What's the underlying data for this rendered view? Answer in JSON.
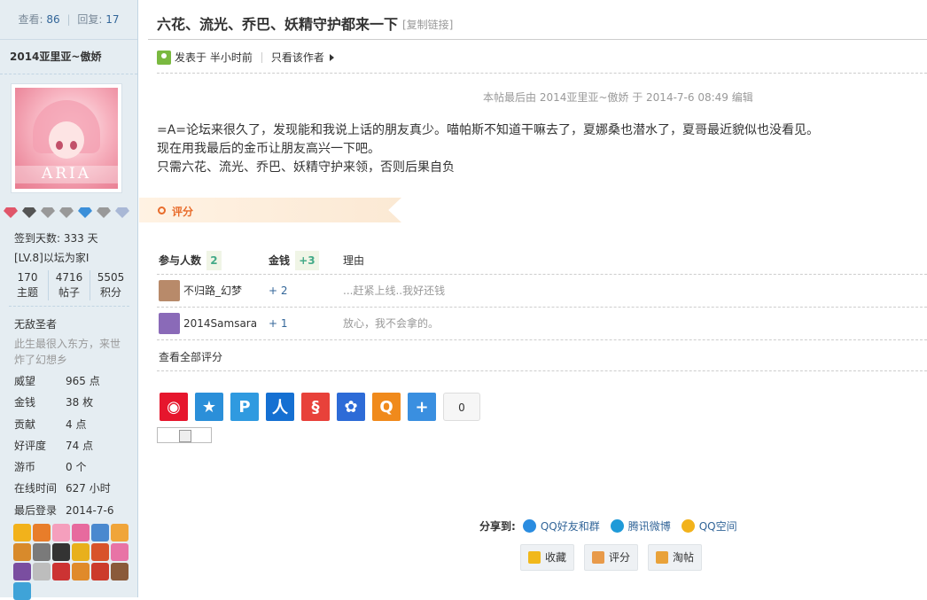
{
  "sidebar": {
    "views_label": "查看:",
    "views": "86",
    "replies_label": "回复:",
    "replies": "17",
    "author": "2014亚里亚~傲娇",
    "avatar_text": "ARIA",
    "checkin": "签到天数: 333 天",
    "level": "[LV.8]以坛为家I",
    "stats": [
      {
        "value": "170",
        "label": "主题"
      },
      {
        "value": "4716",
        "label": "帖子"
      },
      {
        "value": "5505",
        "label": "积分"
      }
    ],
    "title": "无敌圣者",
    "signature": "此生最很入东方，来世炸了幻想乡",
    "props": [
      {
        "k": "威望",
        "v": "965 点"
      },
      {
        "k": "金钱",
        "v": "38 枚"
      },
      {
        "k": "贡献",
        "v": "4 点"
      },
      {
        "k": "好评度",
        "v": "74 点"
      },
      {
        "k": "游币",
        "v": "0 个"
      },
      {
        "k": "在线时间",
        "v": "627 小时"
      },
      {
        "k": "最后登录",
        "v": "2014-7-6"
      }
    ],
    "gem_colors": [
      "#e0566a",
      "#555",
      "#999",
      "#999",
      "#3b8fd9",
      "#999",
      "#a9b8d6"
    ],
    "badge_colors": [
      "#f2b21b",
      "#e87d2a",
      "#f59fbd",
      "#e76a9e",
      "#4a89cf",
      "#f0a53a",
      "#d88a2b",
      "#7a7a7a",
      "#333",
      "#e8b01c",
      "#d8532b",
      "#e873a6",
      "#7a4ea0",
      "#bdbdbd",
      "#c33",
      "#e08a2a",
      "#cc3b2b",
      "#8a5a3a",
      "#3fa3d8"
    ]
  },
  "post": {
    "title": "六花、流光、乔巴、妖精守护都来一下",
    "copy_link": "[复制链接]",
    "posted": "发表于 半小时前",
    "only_author": "只看该作者",
    "edited": "本帖最后由 2014亚里亚~傲娇 于 2014-7-6 08:49 编辑",
    "lines": [
      "=A=论坛来很久了，发现能和我说上话的朋友真少。喵帕斯不知道干嘛去了，夏娜桑也潜水了，夏哥最近貌似也没看见。",
      "现在用我最后的金币让朋友高兴一下吧。",
      "只需六花、流光、乔巴、妖精守护来领，否则后果自负"
    ]
  },
  "rating": {
    "label": "评分",
    "participants_label": "参与人数",
    "participants": "2",
    "money_label": "金钱",
    "money_total": "+3",
    "reason_label": "理由",
    "rows": [
      {
        "user": "不归路_幻梦",
        "points": "+ 2",
        "reason": "...赶紧上线..我好还钱",
        "avatar_color": "#b88a6a"
      },
      {
        "user": "2014Samsara",
        "points": "+ 1",
        "reason": "放心，我不会拿的。",
        "avatar_color": "#8a6ab8"
      }
    ],
    "view_all": "查看全部评分"
  },
  "share": {
    "icons": [
      {
        "name": "weibo-share-icon",
        "color": "#e6162d",
        "glyph": "◉"
      },
      {
        "name": "qzone-share-icon",
        "color": "#2b8fd9",
        "glyph": "★"
      },
      {
        "name": "tencent-weibo-share-icon",
        "color": "#2f9ae0",
        "glyph": "P"
      },
      {
        "name": "renren-share-icon",
        "color": "#1570d2",
        "glyph": "人"
      },
      {
        "name": "kaixin-share-icon",
        "color": "#e8413a",
        "glyph": "§"
      },
      {
        "name": "baidu-share-icon",
        "color": "#2d6bd7",
        "glyph": "✿"
      },
      {
        "name": "qq-bookmark-share-icon",
        "color": "#f08a1c",
        "glyph": "Q"
      },
      {
        "name": "more-share-icon",
        "color": "#3a8fe0",
        "glyph": "+"
      }
    ],
    "count": "0",
    "share_to_label": "分享到:",
    "targets": [
      {
        "label": "QQ好友和群",
        "color": "#2a8ce0"
      },
      {
        "label": "腾讯微博",
        "color": "#1f9ad8"
      },
      {
        "label": "QQ空间",
        "color": "#f2b21b"
      }
    ]
  },
  "actions": [
    {
      "name": "favorite-button",
      "label": "收藏",
      "color": "#f1b81b"
    },
    {
      "name": "rate-button",
      "label": "评分",
      "color": "#e89a4a"
    },
    {
      "name": "tao-post-button",
      "label": "淘帖",
      "color": "#e9a23a"
    }
  ]
}
